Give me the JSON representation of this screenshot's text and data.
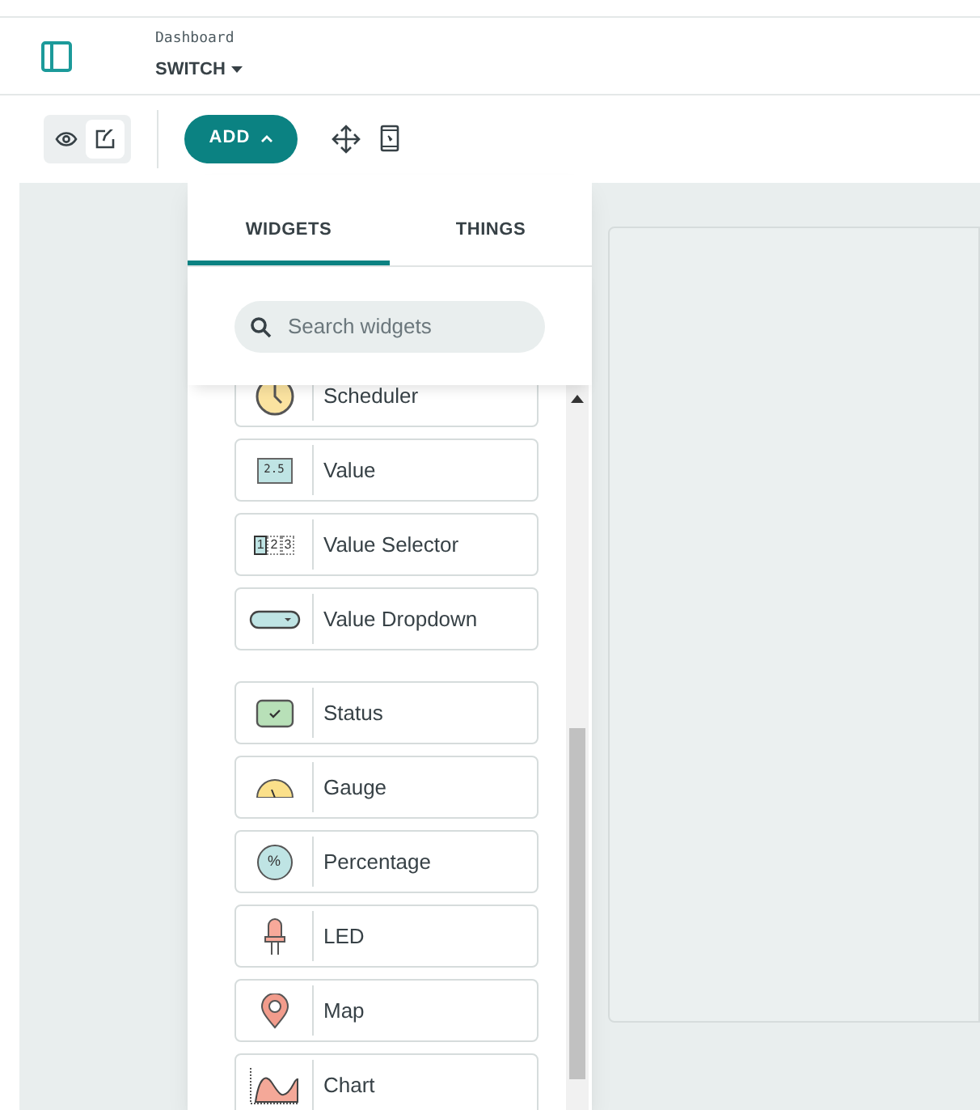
{
  "header": {
    "breadcrumb": "Dashboard",
    "title": "SWITCH"
  },
  "toolbar": {
    "view_mode": {
      "selected": false
    },
    "edit_mode": {
      "selected": true
    },
    "add_button": "ADD"
  },
  "panel": {
    "tabs": [
      {
        "label": "WIDGETS",
        "selected": true
      },
      {
        "label": "THINGS",
        "selected": false
      }
    ],
    "search": {
      "placeholder": "Search widgets"
    },
    "groups": [
      [
        {
          "kind": "scheduler",
          "label": "Scheduler"
        },
        {
          "kind": "value",
          "label": "Value",
          "icon_text": "2.5"
        },
        {
          "kind": "selector",
          "label": "Value Selector",
          "icon_text": [
            "1",
            "2",
            "3"
          ]
        },
        {
          "kind": "dropdown",
          "label": "Value Dropdown"
        }
      ],
      [
        {
          "kind": "status",
          "label": "Status"
        },
        {
          "kind": "gauge",
          "label": "Gauge"
        },
        {
          "kind": "percentage",
          "label": "Percentage",
          "icon_text": "%"
        },
        {
          "kind": "led",
          "label": "LED"
        },
        {
          "kind": "map",
          "label": "Map"
        },
        {
          "kind": "chart",
          "label": "Chart"
        }
      ]
    ]
  }
}
